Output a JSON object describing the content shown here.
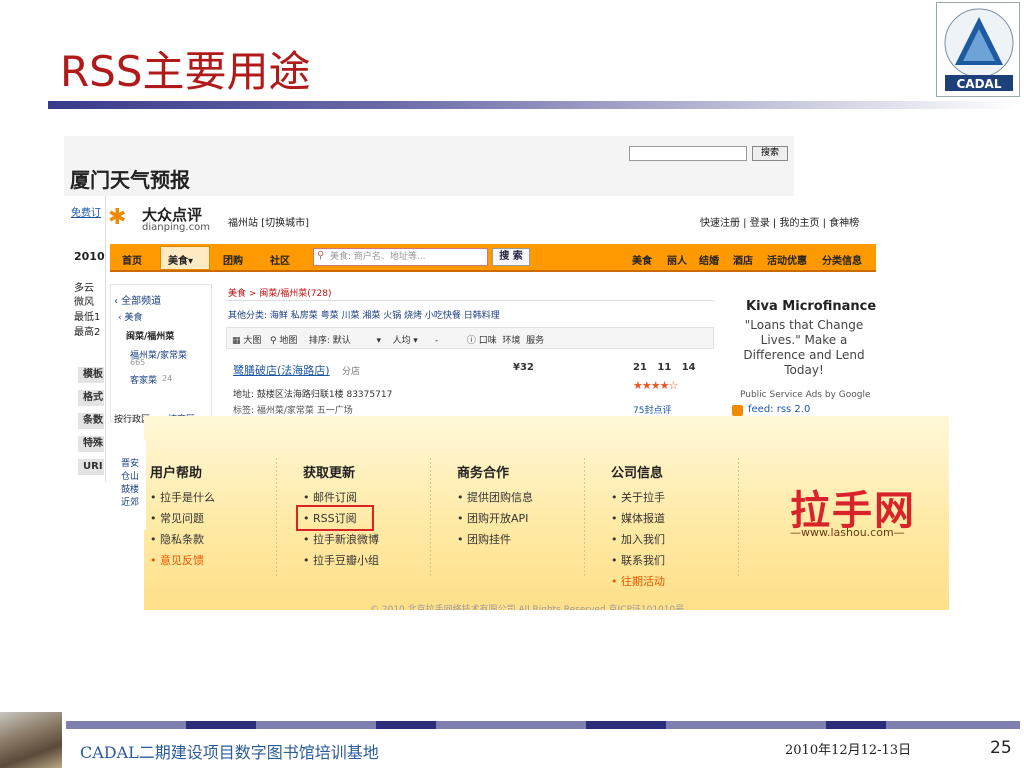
{
  "slide": {
    "title": "RSS主要用途",
    "footer_left": "CADAL二期建设项目数字图书馆培训基地",
    "footer_date": "2010年12月12-13日",
    "page_number": "25",
    "logo_text": "CADAL"
  },
  "weather": {
    "title": "厦门天气预报",
    "search_button": "搜索",
    "left_lines": [
      "免费订",
      "2010",
      "多云",
      "微风",
      "最低1",
      "最高2"
    ],
    "left_buttons": [
      "模板",
      "格式",
      "条数",
      "特殊",
      "URI"
    ],
    "left_bottom": [
      "全部",
      "晋安",
      "仓山",
      "鼓楼",
      "近郊"
    ]
  },
  "dianping": {
    "logo_cn": "大众点评",
    "logo_en": "dianping.com",
    "city": "福州站 [切换城市]",
    "top_links": "快速注册 | 登录 | 我的主页 | 食神榜",
    "nav_left": [
      "首页",
      "美食▾",
      "团购",
      "社区"
    ],
    "search_placeholder": "美食: 商户名、地址等...",
    "search_button": "搜 索",
    "nav_right": [
      "美食",
      "丽人",
      "结婚",
      "酒店",
      "活动优惠",
      "分类信息"
    ],
    "side": {
      "all_channels": "‹ 全部频道",
      "food": "‹ 美食",
      "cuisine": "闽菜/福州菜",
      "sub1": "福州菜/家常菜",
      "sub1_count": "665",
      "sub2": "客家菜",
      "sub2_count": "24",
      "tab1": "按行政区",
      "tab2": "按商区"
    },
    "breadcrumb": "美食 > 闽菜/福州菜(728)",
    "categories": "其他分类: 海鲜 私房菜 粤菜 川菜 湘菜 火锅 烧烤 小吃快餐 日韩料理",
    "filter": "▦ 大图   ⚲ 地图    排序: 默认         ▾    人均 ▾      -          ⓘ 口味  环境  服务",
    "shop_name": "鹭膳破店(法海路店)",
    "shop_branch": "分店",
    "price": "¥32",
    "scores": "21   11   14",
    "address": "地址: 鼓楼区法海路归联1楼 83375717",
    "tags": "标签: 福州菜/家常菜 五一广场",
    "reviews": "75封点评",
    "ad_title": "Kiva Microfinance",
    "ad_body": "\"Loans that Change Lives.\" Make a Difference and Lend Today!",
    "ad_foot": "Public Service Ads by Google",
    "feed": "feed: rss 2.0"
  },
  "lashou": {
    "columns": [
      {
        "title": "用户帮助",
        "items": [
          "• 拉手是什么",
          "• 常见问题",
          "• 隐私条款",
          "• 意见反馈"
        ]
      },
      {
        "title": "获取更新",
        "items": [
          "• 邮件订阅",
          "• RSS订阅",
          "• 拉手新浪微博",
          "• 拉手豆瓣小组"
        ]
      },
      {
        "title": "商务合作",
        "items": [
          "• 提供团购信息",
          "• 团购开放API",
          "• 团购挂件"
        ]
      },
      {
        "title": "公司信息",
        "items": [
          "• 关于拉手",
          "• 媒体报道",
          "• 加入我们",
          "• 联系我们",
          "• 往期活动"
        ]
      }
    ],
    "logo": "拉手网",
    "url": "—www.lashou.com—",
    "copyright": "© 2010 北京拉手网络技术有限公司   All Rights Reserved   京ICP证101010号"
  }
}
